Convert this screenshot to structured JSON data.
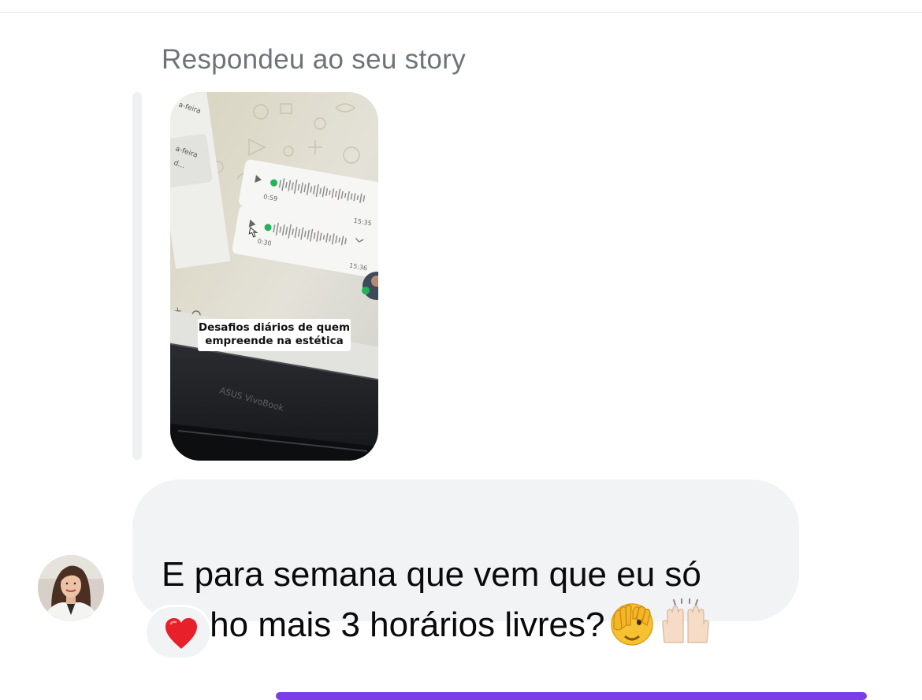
{
  "conversation": {
    "reply_label": "Respondeu ao seu story",
    "story": {
      "caption": "Desafios diários de quem\nempreende na estética",
      "voice_note_1_duration": "0:59",
      "voice_note_1_time": "15:35",
      "voice_note_2_duration": "0:30",
      "voice_note_2_time": "15:36",
      "laptop_brand": "ASUS VivoBook",
      "weekday_fragment": "a-feira"
    },
    "message": {
      "text": "E para semana que vem que eu só\ntenho mais 3 horários livres?",
      "emojis": [
        "face-with-peeking-eye-emoji",
        "raising-hands-emoji"
      ]
    },
    "reaction": {
      "emoji": "red-heart-icon",
      "color": "#e8202a"
    },
    "colors": {
      "bubble_background": "#f2f3f5",
      "secondary_text": "#6f7378",
      "accent": "#7b3ee6"
    }
  }
}
